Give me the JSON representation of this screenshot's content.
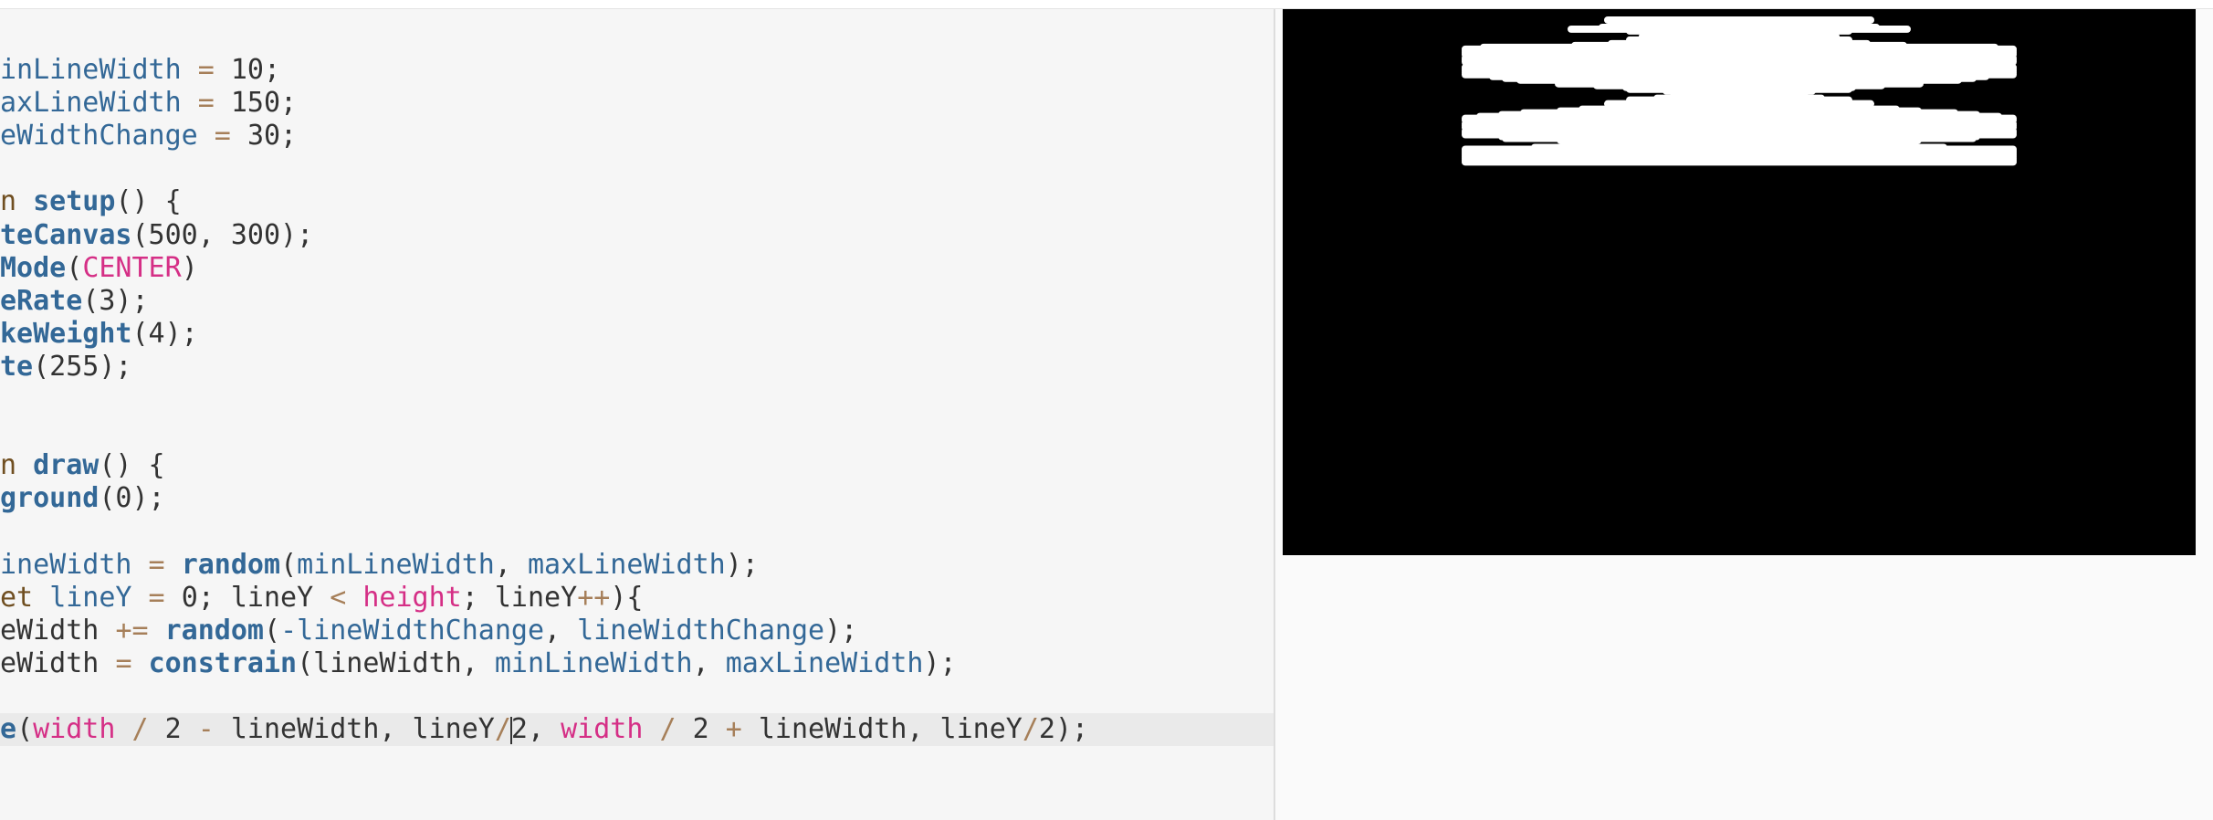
{
  "editor": {
    "lines": [
      {
        "segments": [
          {
            "t": "inLineWidth",
            "c": "var"
          },
          {
            "t": " = ",
            "c": "op"
          },
          {
            "t": "10;",
            "c": "num"
          }
        ]
      },
      {
        "segments": [
          {
            "t": "axLineWidth",
            "c": "var"
          },
          {
            "t": " = ",
            "c": "op"
          },
          {
            "t": "150;",
            "c": "num"
          }
        ]
      },
      {
        "segments": [
          {
            "t": "eWidthChange",
            "c": "var"
          },
          {
            "t": " = ",
            "c": "op"
          },
          {
            "t": "30;",
            "c": "num"
          }
        ]
      },
      {
        "segments": []
      },
      {
        "segments": [
          {
            "t": "n ",
            "c": "kw"
          },
          {
            "t": "setup",
            "c": "fn"
          },
          {
            "t": "() {",
            "c": "num"
          }
        ]
      },
      {
        "segments": [
          {
            "t": "teCanvas",
            "c": "fn"
          },
          {
            "t": "(500, 300);",
            "c": "num"
          }
        ]
      },
      {
        "segments": [
          {
            "t": "Mode",
            "c": "fn"
          },
          {
            "t": "(",
            "c": "num"
          },
          {
            "t": "CENTER",
            "c": "pink"
          },
          {
            "t": ")",
            "c": "num"
          }
        ]
      },
      {
        "segments": [
          {
            "t": "eRate",
            "c": "fn"
          },
          {
            "t": "(3);",
            "c": "num"
          }
        ]
      },
      {
        "segments": [
          {
            "t": "keWeight",
            "c": "fn"
          },
          {
            "t": "(4);",
            "c": "num"
          }
        ]
      },
      {
        "segments": [
          {
            "t": "te",
            "c": "fn"
          },
          {
            "t": "(255);",
            "c": "num"
          }
        ]
      },
      {
        "segments": []
      },
      {
        "segments": []
      },
      {
        "segments": [
          {
            "t": "n ",
            "c": "kw"
          },
          {
            "t": "draw",
            "c": "fn"
          },
          {
            "t": "() {",
            "c": "num"
          }
        ]
      },
      {
        "segments": [
          {
            "t": "ground",
            "c": "fn"
          },
          {
            "t": "(0);",
            "c": "num"
          }
        ]
      },
      {
        "segments": []
      },
      {
        "segments": [
          {
            "t": "ineWidth",
            "c": "var"
          },
          {
            "t": " = ",
            "c": "op"
          },
          {
            "t": "random",
            "c": "fn"
          },
          {
            "t": "(",
            "c": "num"
          },
          {
            "t": "minLineWidth",
            "c": "var"
          },
          {
            "t": ", ",
            "c": "num"
          },
          {
            "t": "maxLineWidth",
            "c": "var"
          },
          {
            "t": ");",
            "c": "num"
          }
        ]
      },
      {
        "segments": [
          {
            "t": "et ",
            "c": "kw"
          },
          {
            "t": "lineY",
            "c": "var"
          },
          {
            "t": " = ",
            "c": "op"
          },
          {
            "t": "0; lineY ",
            "c": "num"
          },
          {
            "t": "<",
            "c": "op"
          },
          {
            "t": " ",
            "c": "num"
          },
          {
            "t": "height",
            "c": "pink"
          },
          {
            "t": "; lineY",
            "c": "num"
          },
          {
            "t": "++",
            "c": "op"
          },
          {
            "t": "){",
            "c": "num"
          }
        ]
      },
      {
        "segments": [
          {
            "t": "eWidth ",
            "c": "num"
          },
          {
            "t": "+=",
            "c": "op"
          },
          {
            "t": " ",
            "c": "num"
          },
          {
            "t": "random",
            "c": "fn"
          },
          {
            "t": "(",
            "c": "num"
          },
          {
            "t": "-lineWidthChange",
            "c": "var"
          },
          {
            "t": ", ",
            "c": "num"
          },
          {
            "t": "lineWidthChange",
            "c": "var"
          },
          {
            "t": ");",
            "c": "num"
          }
        ]
      },
      {
        "segments": [
          {
            "t": "eWidth ",
            "c": "num"
          },
          {
            "t": "=",
            "c": "op"
          },
          {
            "t": " ",
            "c": "num"
          },
          {
            "t": "constrain",
            "c": "fn"
          },
          {
            "t": "(lineWidth, ",
            "c": "num"
          },
          {
            "t": "minLineWidth",
            "c": "var"
          },
          {
            "t": ", ",
            "c": "num"
          },
          {
            "t": "maxLineWidth",
            "c": "var"
          },
          {
            "t": ");",
            "c": "num"
          }
        ]
      },
      {
        "segments": []
      },
      {
        "segments": [
          {
            "t": "e",
            "c": "fn"
          },
          {
            "t": "(",
            "c": "num"
          },
          {
            "t": "width",
            "c": "pink"
          },
          {
            "t": " / ",
            "c": "op"
          },
          {
            "t": "2 ",
            "c": "num"
          },
          {
            "t": "-",
            "c": "op"
          },
          {
            "t": " lineWidth, lineY",
            "c": "num"
          },
          {
            "t": "/",
            "c": "op"
          },
          {
            "t": "|caret|",
            "c": "caret"
          },
          {
            "t": "2, ",
            "c": "num"
          },
          {
            "t": "width",
            "c": "pink"
          },
          {
            "t": " / ",
            "c": "op"
          },
          {
            "t": "2 ",
            "c": "num"
          },
          {
            "t": "+",
            "c": "op"
          },
          {
            "t": " lineWidth, lineY",
            "c": "num"
          },
          {
            "t": "/",
            "c": "op"
          },
          {
            "t": "2);",
            "c": "num"
          }
        ],
        "active": true
      }
    ]
  },
  "sketch": {
    "background_color": "#000000",
    "stroke_color": "#ffffff",
    "canvas_width_units": 500,
    "canvas_height_units": 300,
    "stroke_weight": 4,
    "lines": [
      [
        6,
        72
      ],
      [
        7,
        48
      ],
      [
        8,
        70
      ],
      [
        9,
        38
      ],
      [
        10,
        75
      ],
      [
        11,
        92
      ],
      [
        12,
        60
      ],
      [
        13,
        40
      ],
      [
        14,
        43
      ],
      [
        15,
        53
      ],
      [
        16,
        47
      ],
      [
        17,
        60
      ],
      [
        18,
        58
      ],
      [
        19,
        70
      ],
      [
        20,
        90
      ],
      [
        21,
        140
      ],
      [
        22,
        150
      ],
      [
        23,
        150
      ],
      [
        24,
        150
      ],
      [
        25,
        150
      ],
      [
        26,
        140
      ],
      [
        27,
        150
      ],
      [
        28,
        150
      ],
      [
        29,
        150
      ],
      [
        30,
        148
      ],
      [
        31,
        120
      ],
      [
        32,
        150
      ],
      [
        33,
        150
      ],
      [
        34,
        150
      ],
      [
        35,
        150
      ],
      [
        36,
        150
      ],
      [
        37,
        135
      ],
      [
        38,
        128
      ],
      [
        39,
        120
      ],
      [
        40,
        92
      ],
      [
        41,
        99
      ],
      [
        42,
        78
      ],
      [
        43,
        62
      ],
      [
        44,
        60
      ],
      [
        45,
        40
      ],
      [
        46,
        36
      ],
      [
        47,
        34
      ],
      [
        48,
        27
      ],
      [
        49,
        45
      ],
      [
        50,
        60
      ],
      [
        51,
        60
      ],
      [
        52,
        72
      ],
      [
        53,
        44
      ],
      [
        54,
        52
      ],
      [
        55,
        86
      ],
      [
        56,
        98
      ],
      [
        57,
        118
      ],
      [
        58,
        130
      ],
      [
        59,
        142
      ],
      [
        60,
        150
      ],
      [
        61,
        150
      ],
      [
        62,
        148
      ],
      [
        63,
        150
      ],
      [
        64,
        150
      ],
      [
        65,
        150
      ],
      [
        66,
        148
      ],
      [
        67,
        150
      ],
      [
        68,
        150
      ],
      [
        69,
        150
      ],
      [
        70,
        130
      ],
      [
        71,
        128
      ],
      [
        72,
        98
      ],
      [
        73,
        86
      ],
      [
        74,
        72
      ],
      [
        75,
        90
      ],
      [
        76,
        112
      ],
      [
        77,
        150
      ],
      [
        78,
        150
      ],
      [
        79,
        150
      ],
      [
        80,
        150
      ],
      [
        81,
        150
      ],
      [
        82,
        150
      ],
      [
        83,
        150
      ],
      [
        84,
        150
      ]
    ]
  }
}
